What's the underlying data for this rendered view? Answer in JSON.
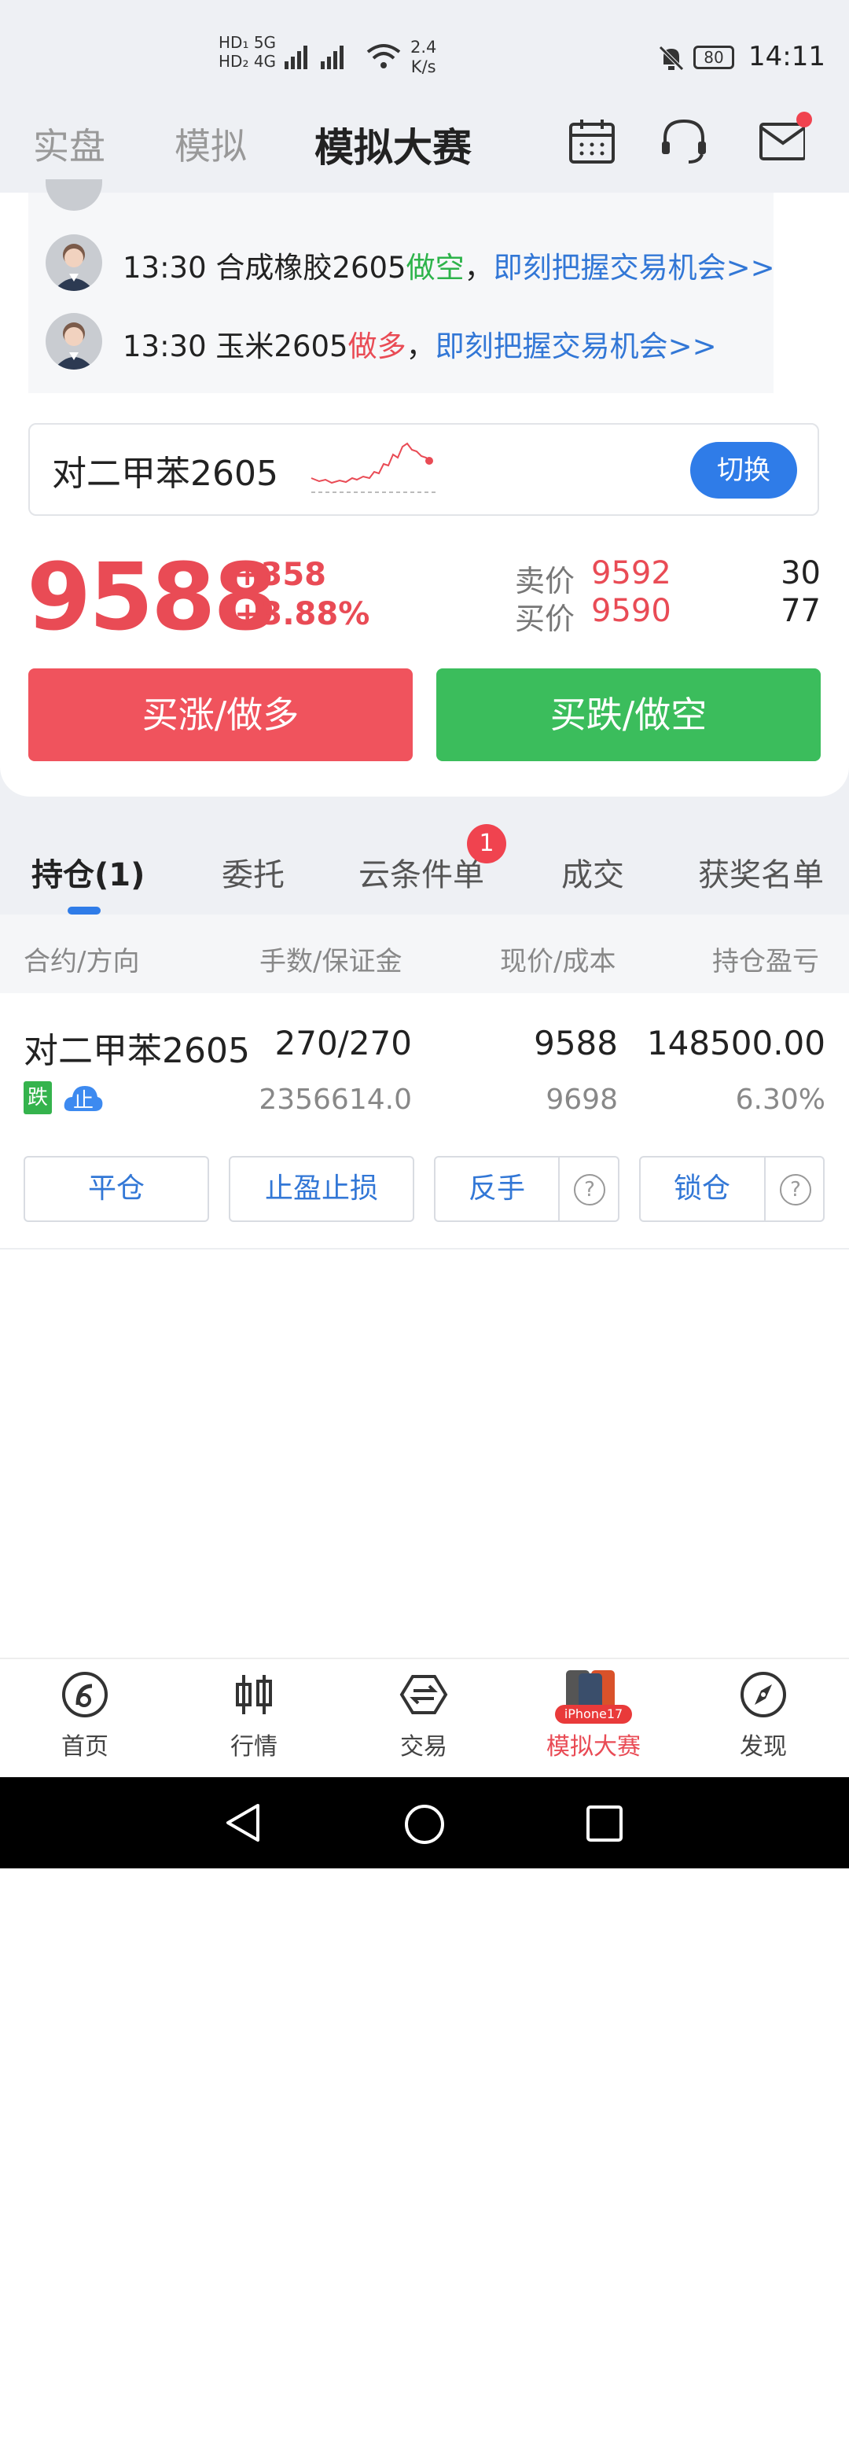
{
  "status_bar": {
    "net1": "HD₁ 5G",
    "net2": "HD₂ 4G",
    "speed": "2.4",
    "speed_unit": "K/s",
    "battery": "80",
    "time": "14:11"
  },
  "top_nav": {
    "tabs": [
      "实盘",
      "模拟",
      "模拟大赛"
    ],
    "active_tab": "模拟大赛"
  },
  "ticker": {
    "rows": [
      {
        "time": "13:30",
        "product": "合成橡胶2605",
        "direction": "做空",
        "direction_color": "green",
        "sep": "，",
        "link": "即刻把握交易机会>>"
      },
      {
        "time": "13:30",
        "product": "玉米2605",
        "direction": "做多",
        "direction_color": "red",
        "sep": "，",
        "link": "即刻把握交易机会>>"
      }
    ]
  },
  "contract": {
    "name": "对二甲苯2605",
    "switch_label": "切换"
  },
  "quote": {
    "price": "9588",
    "change": "+358",
    "change_pct": "+3.88%",
    "sell_label": "卖价",
    "sell_price": "9592",
    "sell_volume": "30",
    "buy_label": "买价",
    "buy_price": "9590",
    "buy_volume": "77"
  },
  "actions": {
    "buy_up": "买涨/做多",
    "buy_down": "买跌/做空"
  },
  "sub_tabs": {
    "items": [
      "持仓(1)",
      "委托",
      "云条件单",
      "成交",
      "获奖名单"
    ],
    "badge": "1"
  },
  "columns": [
    "合约/方向",
    "手数/保证金",
    "现价/成本",
    "持仓盈亏"
  ],
  "position": {
    "name": "对二甲苯2605",
    "tag_direction": "跌",
    "tag_stop": "止",
    "lots": "270/270",
    "margin": "2356614.0",
    "current": "9588",
    "cost": "9698",
    "pnl": "148500.00",
    "pnl_pct": "6.30%",
    "buttons": {
      "close": "平仓",
      "tp_sl": "止盈止损",
      "reverse": "反手",
      "lock": "锁仓",
      "help": "?"
    }
  },
  "bottom_nav": {
    "items": [
      "首页",
      "行情",
      "交易",
      "模拟大赛",
      "发现"
    ],
    "active": "模拟大赛",
    "promo_label": "iPhone17"
  },
  "colors": {
    "red": "#e94b55",
    "green": "#3bbd5c",
    "blue": "#3277d6",
    "accent": "#2f7ce8"
  }
}
